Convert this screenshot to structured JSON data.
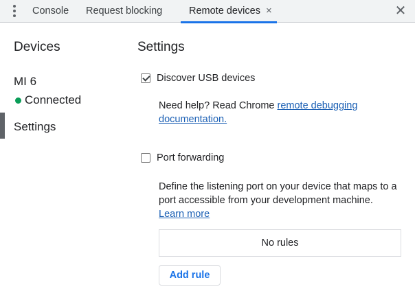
{
  "tabbar": {
    "tabs": [
      {
        "label": "Console"
      },
      {
        "label": "Request blocking"
      },
      {
        "label": "Remote devices",
        "close_glyph": "×",
        "selected": true
      }
    ],
    "close_glyph": "✕",
    "accent_color": "#1a73e8"
  },
  "sidebar": {
    "title": "Devices",
    "device": {
      "name": "MI 6",
      "status": "Connected",
      "status_color": "#0a9d58"
    },
    "settings_label": "Settings"
  },
  "settings": {
    "title": "Settings",
    "discover_usb": {
      "label": "Discover USB devices",
      "checked": true
    },
    "help": {
      "prefix": "Need help? Read Chrome ",
      "link": "remote debugging documentation."
    },
    "port_forwarding": {
      "label": "Port forwarding",
      "checked": false,
      "description": "Define the listening port on your device that maps to a port accessible from your development machine.",
      "learn_more": "Learn more",
      "empty_rules": "No rules",
      "add_rule": "Add rule"
    }
  }
}
